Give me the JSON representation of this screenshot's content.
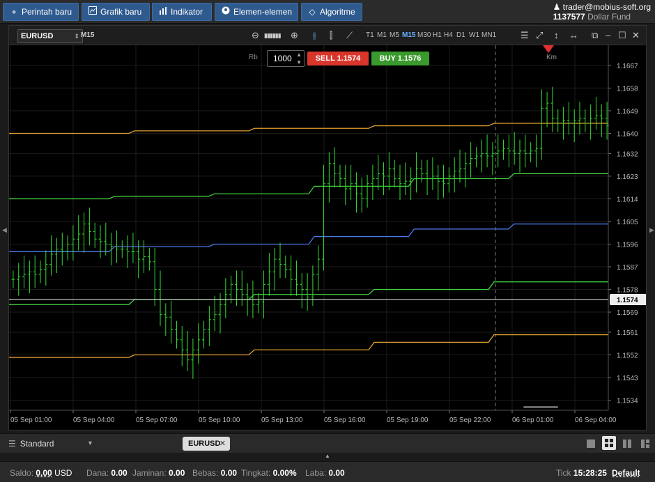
{
  "toolbar": {
    "new_order": "Perintah baru",
    "new_chart": "Grafik baru",
    "indicator": "Indikator",
    "elements": "Elemen-elemen",
    "algorithm": "Algoritme"
  },
  "user": {
    "email": "trader@mobius-soft.org",
    "account_id": "1137577",
    "account_name": "Dollar Fund"
  },
  "chart_tool": {
    "symbol": "EURUSD",
    "timeframe": "M15",
    "timeframes": [
      "T1",
      "M1",
      "M5",
      "M15",
      "M30",
      "H1",
      "H4",
      "D1",
      "W1",
      "MN1"
    ],
    "active_timeframe": "M15"
  },
  "order": {
    "rb_label": "Rb",
    "quantity": "1000",
    "sell_label": "SELL 1.1574",
    "buy_label": "BUY 1.1576"
  },
  "marker_label": "Km",
  "current_price": "1.1574",
  "colors": {
    "up": "#33dd33",
    "down": "#33dd33",
    "orange": "#e0a030",
    "green_band": "#40d040",
    "blue_band": "#4a7ae8",
    "sell": "#d9362b",
    "buy": "#3a9a2d",
    "marker": "#e03030"
  },
  "chart_data": {
    "type": "candlestick",
    "price_axis": [
      "1.1667",
      "1.1658",
      "1.1649",
      "1.1640",
      "1.1632",
      "1.1623",
      "1.1614",
      "1.1605",
      "1.1596",
      "1.1587",
      "1.1578",
      "1.1569",
      "1.1561",
      "1.1552",
      "1.1543",
      "1.1534"
    ],
    "time_axis": [
      "05 Sep 01:00",
      "05 Sep 04:00",
      "05 Sep 07:00",
      "05 Sep 10:00",
      "05 Sep 13:00",
      "05 Sep 16:00",
      "05 Sep 19:00",
      "05 Sep 22:00",
      "06 Sep 01:00",
      "06 Sep 04:00"
    ],
    "ylim": [
      1.153,
      1.1675
    ],
    "close_series": [
      1.1582,
      1.1583,
      1.1584,
      1.1585,
      1.1584,
      1.1586,
      1.1588,
      1.1592,
      1.1594,
      1.1593,
      1.1596,
      1.1598,
      1.16,
      1.1604,
      1.1601,
      1.1598,
      1.1597,
      1.1596,
      1.1595,
      1.1594,
      1.1594,
      1.1593,
      1.1593,
      1.159,
      1.1591,
      1.1589,
      1.1578,
      1.1568,
      1.1567,
      1.1562,
      1.1558,
      1.1554,
      1.155,
      1.1554,
      1.1558,
      1.1562,
      1.1566,
      1.1568,
      1.1572,
      1.1576,
      1.158,
      1.1578,
      1.1576,
      1.1575,
      1.1572,
      1.1573,
      1.158,
      1.1585,
      1.159,
      1.1588,
      1.1586,
      1.1582,
      1.158,
      1.1578,
      1.1575,
      1.1584,
      1.159,
      1.162,
      1.1628,
      1.1624,
      1.1622,
      1.1618,
      1.162,
      1.1616,
      1.1614,
      1.162,
      1.1622,
      1.1624,
      1.1623,
      1.1626,
      1.1622,
      1.162,
      1.1621,
      1.1622,
      1.1626,
      1.1624,
      1.1622,
      1.1623,
      1.1621,
      1.162,
      1.1623,
      1.1625,
      1.1626,
      1.1628,
      1.163,
      1.1631,
      1.1632,
      1.1631,
      1.1632,
      1.1633,
      1.1634,
      1.1633,
      1.1632,
      1.1633,
      1.1632,
      1.1633,
      1.1634,
      1.165,
      1.1652,
      1.1646,
      1.1644,
      1.1645,
      1.1644,
      1.1645,
      1.1646,
      1.1644,
      1.1646,
      1.1647,
      1.1646,
      1.1643
    ],
    "series": [
      {
        "name": "",
        "color": "#e0a030",
        "levels": [
          1.164,
          1.1641,
          1.1642,
          1.1643,
          1.1644
        ]
      },
      {
        "name": "",
        "color": "#40d040",
        "levels": [
          1.1614,
          1.1615,
          1.1616,
          1.1619,
          1.1622,
          1.1624
        ]
      },
      {
        "name": "",
        "color": "#4a7ae8",
        "levels": [
          1.1593,
          1.1595,
          1.1596,
          1.1599,
          1.1602,
          1.1604
        ]
      },
      {
        "name": "",
        "color": "#40d040",
        "levels": [
          1.1572,
          1.1574,
          1.1576,
          1.1578,
          1.1581
        ]
      },
      {
        "name": "",
        "color": "#e0a030",
        "levels": [
          1.1551,
          1.1552,
          1.1554,
          1.1557,
          1.156
        ]
      }
    ],
    "title": "",
    "xlabel": "",
    "ylabel": ""
  },
  "tabs": {
    "layout_name": "Standard",
    "open_tab": "EURUSD"
  },
  "status": {
    "balance_label": "Saldo:",
    "balance_value": "0.00",
    "balance_ccy": "USD",
    "fund_label": "Dana:",
    "fund_value": "0.00",
    "margin_label": "Jaminan:",
    "margin_value": "0.00",
    "free_label": "Bebas:",
    "free_value": "0.00",
    "level_label": "Tingkat:",
    "level_value": "0.00%",
    "profit_label": "Laba:",
    "profit_value": "0.00",
    "tick_label": "Tick",
    "time": "15:28:25",
    "profile": "Default"
  }
}
